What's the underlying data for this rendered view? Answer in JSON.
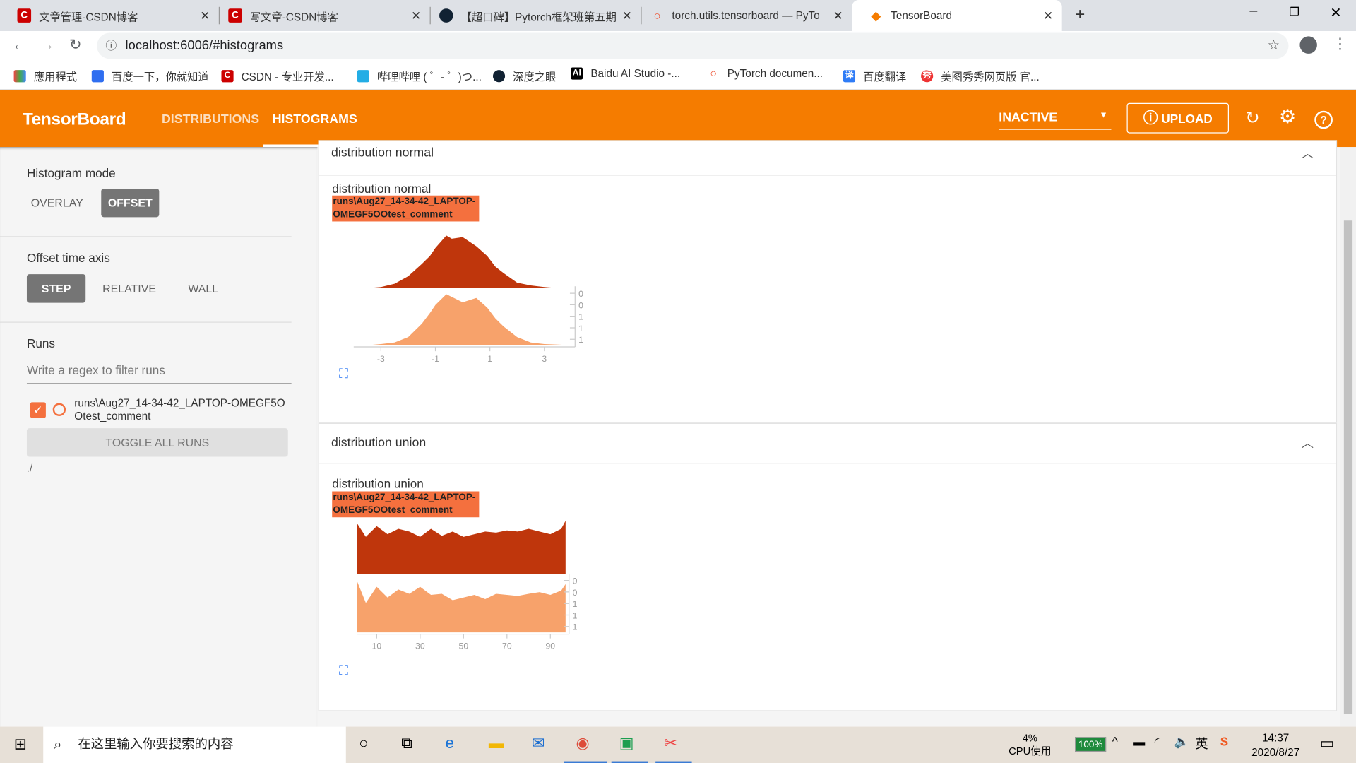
{
  "browser": {
    "tabs": [
      {
        "title": "文章管理-CSDN博客",
        "icon": "csdn-icon"
      },
      {
        "title": "写文章-CSDN博客",
        "icon": "csdn-icon"
      },
      {
        "title": "【超口碑】Pytorch框架班第五期",
        "icon": "deepeye-icon"
      },
      {
        "title": "torch.utils.tensorboard — PyTo",
        "icon": "pytorch-icon"
      },
      {
        "title": "TensorBoard",
        "icon": "tensorboard-icon",
        "active": true
      }
    ],
    "url": "localhost:6006/#histograms",
    "bookmarks": [
      "應用程式",
      "百度一下，你就知道",
      "CSDN - 专业开发...",
      "哔哩哔哩 ( ゜- ゜)つ...",
      "深度之眼",
      "Baidu AI Studio -...",
      "PyTorch documen...",
      "百度翻译",
      "美图秀秀网页版 官..."
    ]
  },
  "header": {
    "brand": "TensorBoard",
    "nav": [
      "DISTRIBUTIONS",
      "HISTOGRAMS"
    ],
    "active_nav": "HISTOGRAMS",
    "inactive_select": "INACTIVE",
    "upload": "UPLOAD",
    "accent": "#f57c00"
  },
  "sidebar": {
    "histogram_mode_label": "Histogram mode",
    "modes": [
      "OVERLAY",
      "OFFSET"
    ],
    "selected_mode": "OFFSET",
    "time_axis_label": "Offset time axis",
    "axes": [
      "STEP",
      "RELATIVE",
      "WALL"
    ],
    "selected_axis": "STEP",
    "runs_label": "Runs",
    "filter_placeholder": "Write a regex to filter runs",
    "run_name": "runs\\Aug27_14-34-42_LAPTOP-OMEGF5O Otest_comment",
    "run_checked": true,
    "toggle_all": "TOGGLE ALL RUNS",
    "logdir": "./"
  },
  "cards": [
    {
      "header": "distribution normal",
      "title": "distribution normal",
      "run_tag": "runs\\Aug27_14-34-42_LAPTOP-OMEGF5OOtest_comment",
      "x_ticks": [
        "-3",
        "-1",
        "1",
        "3"
      ],
      "y_ticks": [
        "0",
        "0",
        "1",
        "1",
        "1"
      ]
    },
    {
      "header": "distribution union",
      "title": "distribution union",
      "run_tag": "runs\\Aug27_14-34-42_LAPTOP-OMEGF5OOtest_comment",
      "x_ticks": [
        "10",
        "30",
        "50",
        "70",
        "90"
      ],
      "y_ticks": [
        "0",
        "0",
        "1",
        "1",
        "1"
      ]
    }
  ],
  "chart_data": [
    {
      "type": "area",
      "title": "distribution normal",
      "xlim": [
        -4,
        4
      ],
      "x": [
        -4,
        -3.5,
        -3,
        -2.5,
        -2,
        -1.5,
        -1.2,
        -1,
        -0.6,
        -0.4,
        0,
        0.5,
        0.9,
        1.2,
        1.5,
        2,
        2.5,
        3,
        3.5,
        4
      ],
      "series": [
        {
          "values": [
            0,
            0,
            0.02,
            0.08,
            0.22,
            0.45,
            0.6,
            0.75,
            0.98,
            0.92,
            0.95,
            0.78,
            0.6,
            0.4,
            0.28,
            0.1,
            0.05,
            0.02,
            0,
            0
          ],
          "color": "#bf360c"
        },
        {
          "values": [
            0,
            0,
            0.02,
            0.05,
            0.15,
            0.4,
            0.6,
            0.75,
            0.95,
            0.9,
            0.8,
            0.88,
            0.7,
            0.5,
            0.35,
            0.15,
            0.05,
            0.02,
            0.01,
            0
          ],
          "color": "#f7a26b"
        }
      ]
    },
    {
      "type": "area",
      "title": "distribution union",
      "xlim": [
        1,
        97
      ],
      "x": [
        1,
        5,
        10,
        15,
        20,
        25,
        30,
        35,
        40,
        45,
        50,
        55,
        60,
        65,
        70,
        75,
        80,
        85,
        90,
        95,
        97
      ],
      "series": [
        {
          "values": [
            0.95,
            0.7,
            0.9,
            0.75,
            0.85,
            0.8,
            0.7,
            0.85,
            0.72,
            0.8,
            0.7,
            0.75,
            0.8,
            0.78,
            0.82,
            0.8,
            0.85,
            0.8,
            0.75,
            0.85,
            1.0
          ],
          "color": "#bf360c"
        },
        {
          "values": [
            0.95,
            0.55,
            0.85,
            0.65,
            0.8,
            0.72,
            0.85,
            0.7,
            0.72,
            0.6,
            0.65,
            0.7,
            0.62,
            0.72,
            0.7,
            0.68,
            0.72,
            0.75,
            0.7,
            0.78,
            0.9
          ],
          "color": "#f7a26b"
        }
      ]
    }
  ],
  "taskbar": {
    "search_placeholder": "在这里输入你要搜索的内容",
    "cpu": "4%",
    "cpu_label": "CPU使用",
    "battery": "100%",
    "ime": "英",
    "time": "14:37",
    "date": "2020/8/27"
  }
}
